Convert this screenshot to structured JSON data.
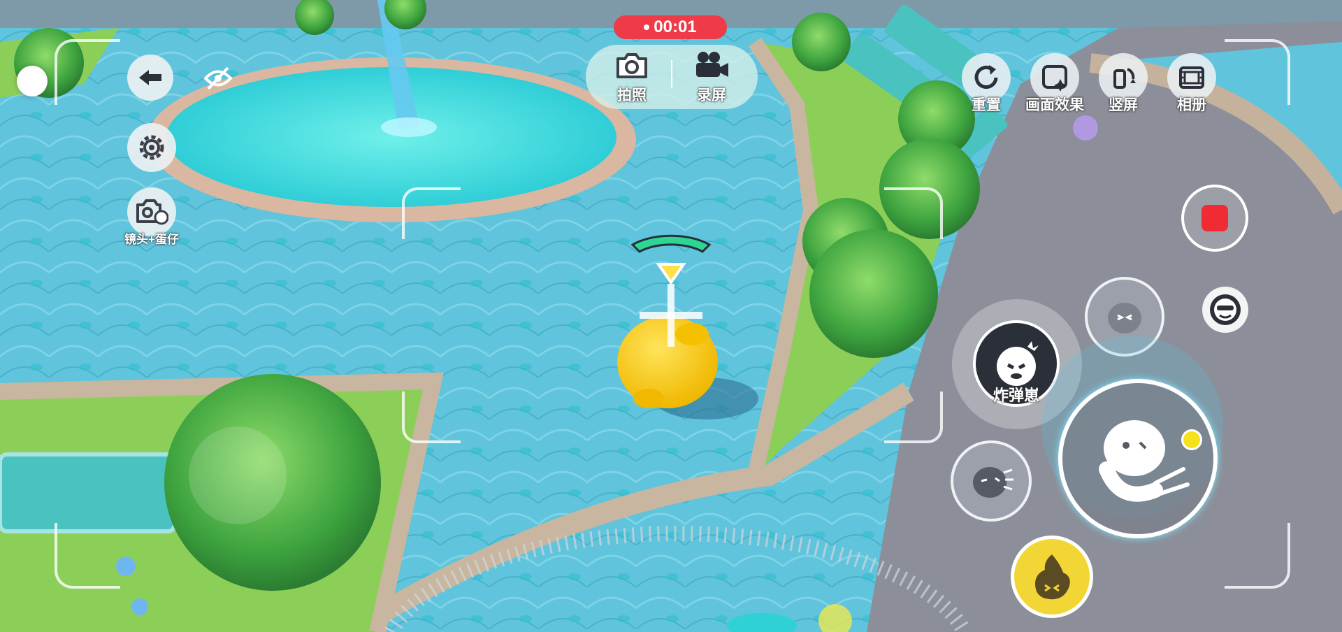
{
  "recording": {
    "timer": "00:01"
  },
  "capture_mode": {
    "photo_label": "拍照",
    "record_label": "录屏",
    "selected": "录屏"
  },
  "left_panel": {
    "camera_egg_label": "镜头+蛋仔"
  },
  "top_right_tools": [
    {
      "label": "重置",
      "icon": "refresh-icon"
    },
    {
      "label": "画面效果",
      "icon": "effects-icon"
    },
    {
      "label": "竖屏",
      "icon": "rotate-icon"
    },
    {
      "label": "相册",
      "icon": "film-icon"
    }
  ],
  "skills": {
    "bomb_label": "炸弹崽"
  },
  "colors": {
    "timer_bg": "#ee3b47",
    "stop_red": "#f02b33",
    "egg_yellow": "#f7c815",
    "pool_cyan": "#3ed8dc",
    "grass": "#8ccf58",
    "health_green": "#2fd595"
  }
}
